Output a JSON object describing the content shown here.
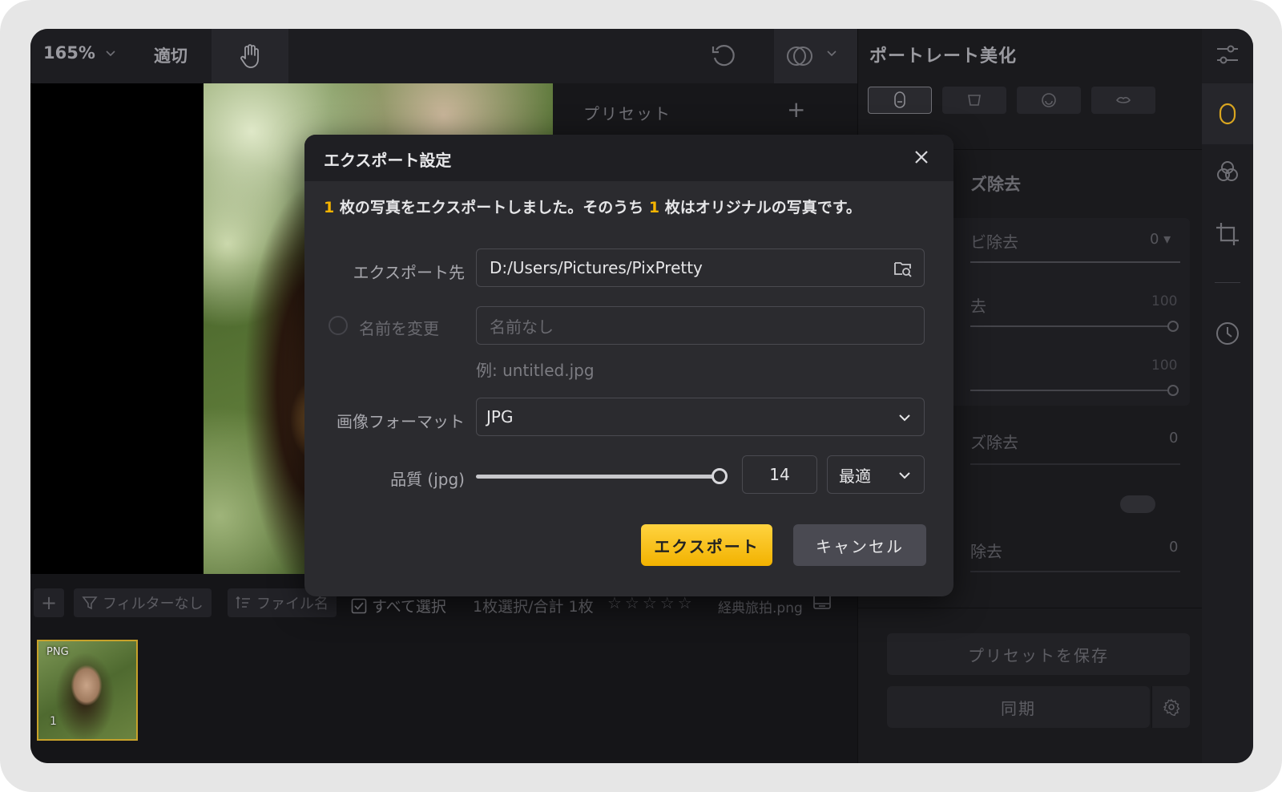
{
  "toolbar": {
    "zoom": "165%",
    "fit": "適切"
  },
  "preset_panel": {
    "title": "プリセット",
    "add": "+"
  },
  "bottom_toolbar": {
    "add": "+",
    "filter": "フィルターなし",
    "sort": "ファイル名",
    "select_all": "すべて選択",
    "count": "1枚選択/合計 1枚",
    "rating": "☆☆☆☆☆",
    "filename": "経典旅拍.png"
  },
  "thumbnail": {
    "format": "PNG",
    "index": "1"
  },
  "right_panel": {
    "title": "ポートレート美化",
    "section_title": "ズ除去",
    "rows": [
      {
        "label": "ビ除去",
        "value": "0 ▾"
      },
      {
        "label": "去",
        "value": "100"
      },
      {
        "label": "",
        "value": "100"
      },
      {
        "label": "ズ除去",
        "value": "0"
      },
      {
        "label": "除去",
        "value": "0"
      }
    ],
    "save_preset": "プリセットを保存",
    "sync": "同期"
  },
  "dialog": {
    "title": "エクスポート設定",
    "message_parts": [
      "1",
      " 枚の写真をエクスポートしました。そのうち ",
      "1",
      " 枚はオリジナルの写真です。"
    ],
    "dest_label": "エクスポート先",
    "dest_value": "D:/Users/Pictures/PixPretty",
    "rename_label": "名前を変更",
    "rename_placeholder": "名前なし",
    "rename_hint": "例: untitled.jpg",
    "format_label": "画像フォーマット",
    "format_value": "JPG",
    "quality_label": "品質 (jpg)",
    "quality_value": "14",
    "quality_preset": "最適",
    "export_button": "エクスポート",
    "cancel_button": "キャンセル"
  },
  "colors": {
    "accent": "#f5b400",
    "dialog_bg": "#2b2b2f",
    "app_bg": "#151518"
  }
}
